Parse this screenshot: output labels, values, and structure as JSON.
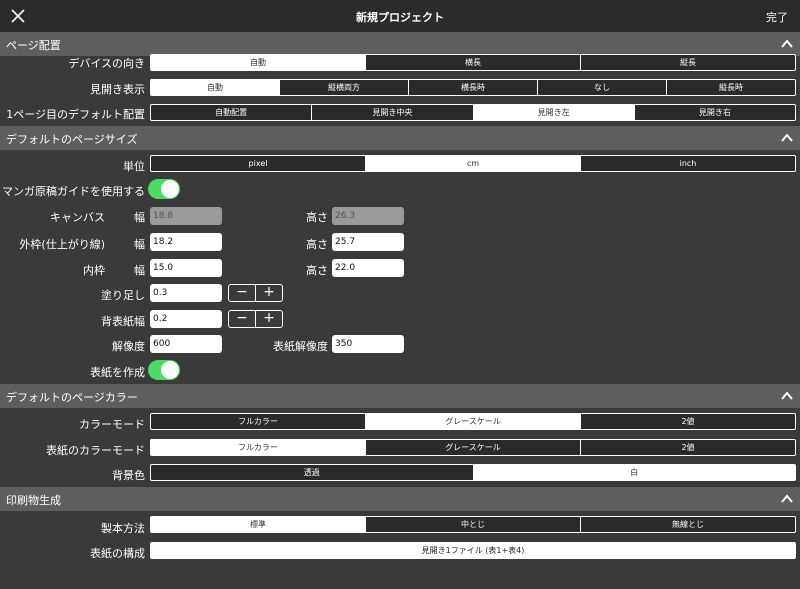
{
  "header": {
    "title": "新規プロジェクト",
    "done_label": "完了"
  },
  "sections": {
    "page_layout": {
      "title": "ページ配置",
      "device_orientation": {
        "label": "デバイスの向き",
        "options": [
          "自動",
          "横長",
          "縦長"
        ],
        "selected": 0
      },
      "spread_display": {
        "label": "見開き表示",
        "options": [
          "自動",
          "縦横両方",
          "横長時",
          "なし",
          "縦長時"
        ],
        "selected": 0
      },
      "first_page_default": {
        "label": "1ページ目のデフォルト配置",
        "options": [
          "自動配置",
          "見開き中央",
          "見開き左",
          "見開き右"
        ],
        "selected": 2
      }
    },
    "page_size": {
      "title": "デフォルトのページサイズ",
      "unit": {
        "label": "単位",
        "options": [
          "pixel",
          "cm",
          "inch"
        ],
        "selected": 1
      },
      "manga_guide": {
        "label": "マンガ原稿ガイドを使用する",
        "on": true
      },
      "canvas": {
        "label": "キャンバス",
        "width_label": "幅",
        "width": "18.8",
        "height_label": "高さ",
        "height": "26.3"
      },
      "outer": {
        "label": "外枠(仕上がり線)",
        "width_label": "幅",
        "width": "18.2",
        "height_label": "高さ",
        "height": "25.7"
      },
      "inner": {
        "label": "内枠",
        "width_label": "幅",
        "width": "15.0",
        "height_label": "高さ",
        "height": "22.0"
      },
      "bleed": {
        "label": "塗り足し",
        "value": "0.3",
        "minus": "−",
        "plus": "+"
      },
      "spine": {
        "label": "背表紙幅",
        "value": "0.2",
        "minus": "−",
        "plus": "+"
      },
      "resolution": {
        "label": "解像度",
        "value": "600",
        "cover_label": "表紙解像度",
        "cover_value": "350"
      },
      "create_cover": {
        "label": "表紙を作成",
        "on": true
      }
    },
    "page_color": {
      "title": "デフォルトのページカラー",
      "color_mode": {
        "label": "カラーモード",
        "options": [
          "フルカラー",
          "グレースケール",
          "2値"
        ],
        "selected": 1
      },
      "cover_color_mode": {
        "label": "表紙のカラーモード",
        "options": [
          "フルカラー",
          "グレースケール",
          "2値"
        ],
        "selected": 0
      },
      "background": {
        "label": "背景色",
        "options": [
          "透過",
          "白"
        ],
        "selected": 1
      }
    },
    "print": {
      "title": "印刷物生成",
      "binding": {
        "label": "製本方法",
        "options": [
          "標準",
          "中とじ",
          "無線とじ"
        ],
        "selected": 0
      },
      "cover_structure": {
        "label": "表紙の構成",
        "value": "見開き1ファイル (表1+表4)"
      }
    }
  },
  "colors": {
    "toggle_on": "#4cd964",
    "background": "#3a3a3a",
    "section_header": "#5e5e5e",
    "titlebar": "#2b2b2b"
  },
  "icons": {
    "close": "close-icon",
    "collapse": "chevron-up-icon"
  }
}
